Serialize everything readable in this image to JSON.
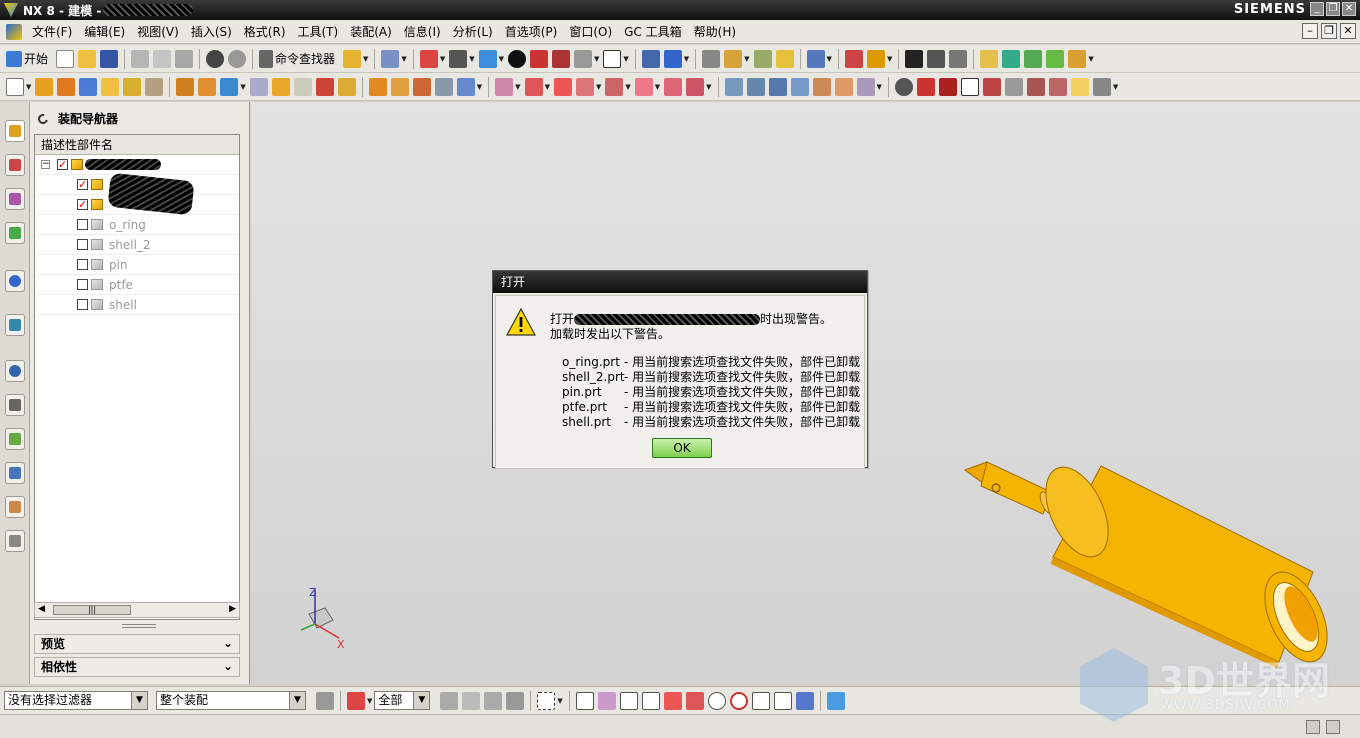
{
  "window": {
    "title": "NX 8 - 建模 -",
    "brand": "SIEMENS"
  },
  "menu": [
    "文件(F)",
    "编辑(E)",
    "视图(V)",
    "插入(S)",
    "格式(R)",
    "工具(T)",
    "装配(A)",
    "信息(I)",
    "分析(L)",
    "首选项(P)",
    "窗口(O)",
    "GC 工具箱",
    "帮助(H)"
  ],
  "toolbar": {
    "start_label": "开始",
    "command_finder_label": "命令查找器"
  },
  "navigator": {
    "title": "装配导航器",
    "column_header": "描述性部件名",
    "parts": [
      {
        "name": "o_ring",
        "checked": false
      },
      {
        "name": "shell_2",
        "checked": false
      },
      {
        "name": "pin",
        "checked": false
      },
      {
        "name": "ptfe",
        "checked": false
      },
      {
        "name": "shell",
        "checked": false
      }
    ],
    "sections": [
      "预览",
      "相依性"
    ]
  },
  "dialog": {
    "title": "打开",
    "line1_prefix": "打开",
    "line1_suffix": "时出现警告。",
    "line2": "加载时发出以下警告。",
    "messages": [
      {
        "file": "o_ring.prt",
        "msg": " - 用当前搜索选项查找文件失败，部件已卸载"
      },
      {
        "file": "shell_2.prt",
        "msg": " - 用当前搜索选项查找文件失败，部件已卸载"
      },
      {
        "file": "pin.prt",
        "msg": " - 用当前搜索选项查找文件失败，部件已卸载"
      },
      {
        "file": "ptfe.prt",
        "msg": " - 用当前搜索选项查找文件失败，部件已卸载"
      },
      {
        "file": "shell.prt",
        "msg": " - 用当前搜索选项查找文件失败，部件已卸载"
      }
    ],
    "ok_label": "OK"
  },
  "bottom": {
    "filter_value": "没有选择过滤器",
    "scope_value": "整个装配",
    "select_value": "全部"
  },
  "triad": {
    "z": "Z",
    "x": "X"
  },
  "watermark": {
    "main": "3D世界网",
    "url": "WWW.3DSJW.COM"
  },
  "colors": {
    "part_yellow": "#f5b400",
    "titlebar": "#1a1a1a",
    "ok_green": "#7fcf4c"
  }
}
